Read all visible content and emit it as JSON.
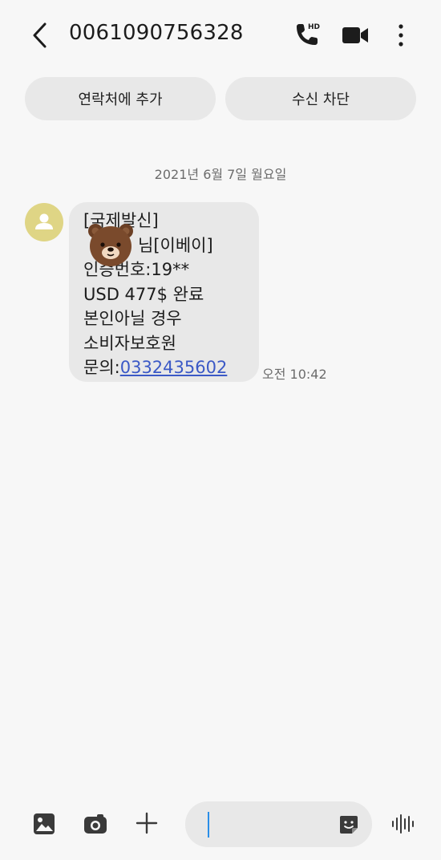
{
  "header": {
    "title": "0061090756328",
    "hd_badge": "HD"
  },
  "actions": {
    "add_contact": "연락처에 추가",
    "block": "수신 차단"
  },
  "conversation": {
    "date": "2021년 6월 7일 월요일",
    "message": {
      "lines": [
        "[국제발신]",
        "님[이베이]",
        "인증번호:19**",
        "USD 477$ 완료",
        "본인아닐 경우",
        "소비자보호원"
      ],
      "inquiry_prefix": "문의:",
      "phone_link": "0332435602",
      "time": "오전 10:42"
    }
  },
  "composer": {
    "placeholder": ""
  },
  "colors": {
    "background": "#f7f7f7",
    "pill": "#e8e8e8",
    "avatar": "#dfd585",
    "link": "#3b59c6",
    "caret": "#2a8ee8"
  }
}
